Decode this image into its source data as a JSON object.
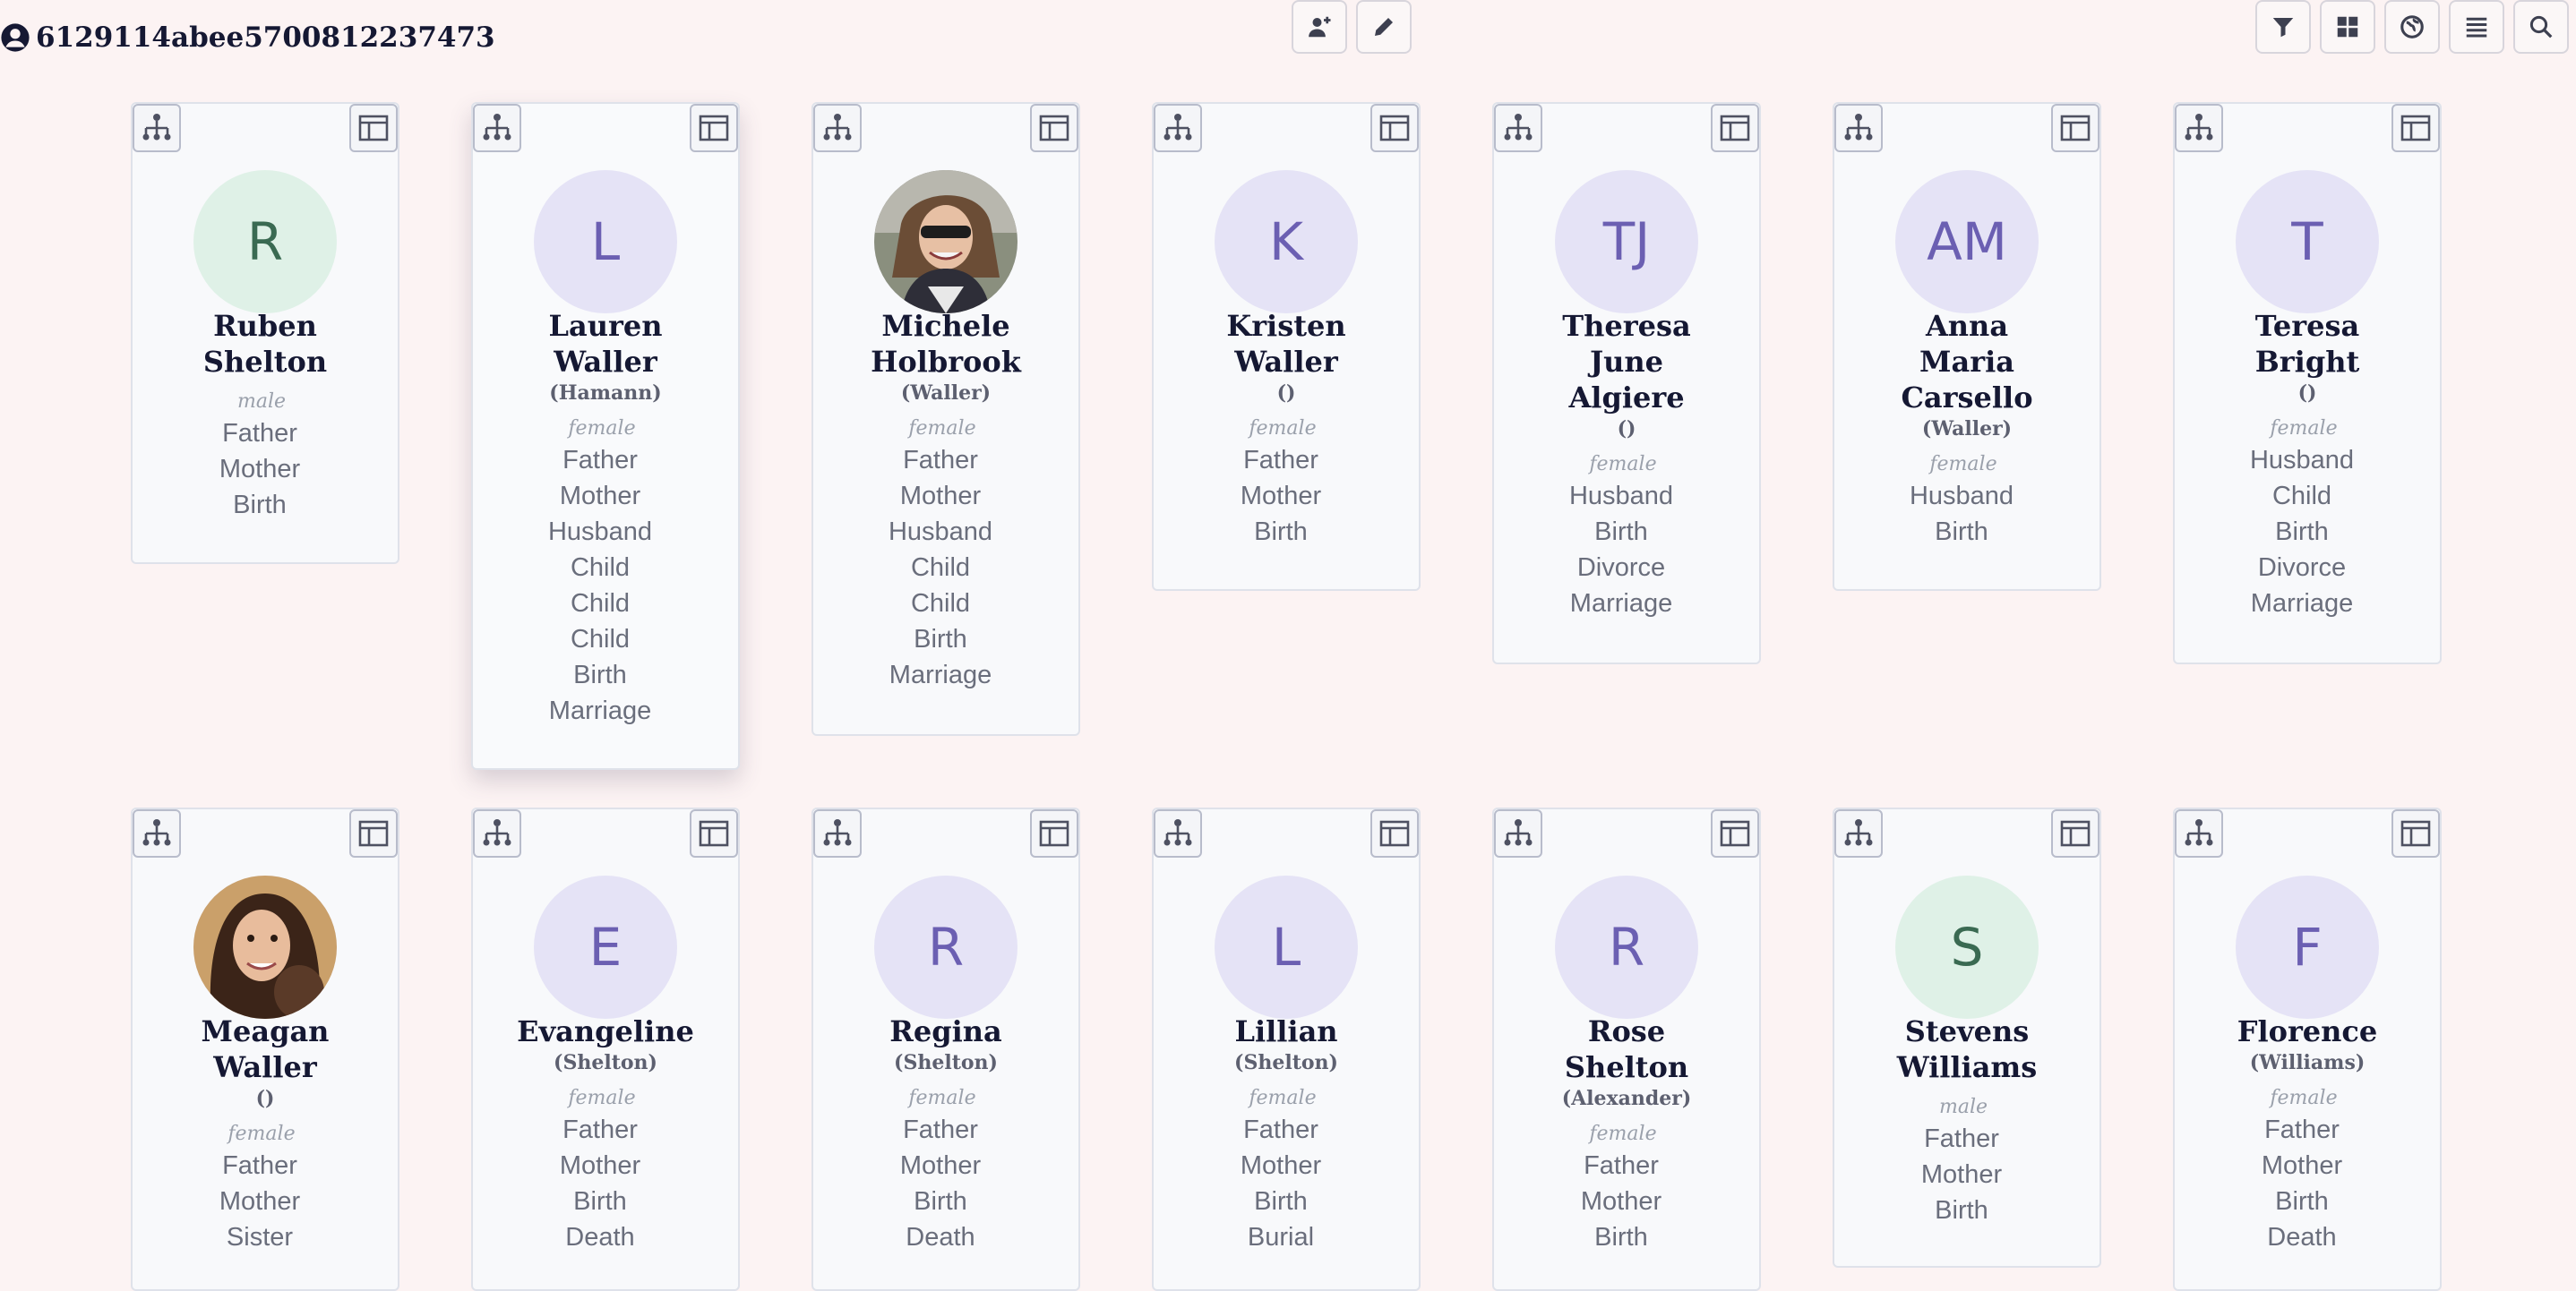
{
  "header": {
    "id_text": "6129114abee5700812237473"
  },
  "icons": {
    "person": "person-icon",
    "add_person": "add-person-icon",
    "edit": "pencil-icon",
    "filter": "filter-icon",
    "grid": "grid-icon",
    "globe": "globe-icon",
    "list": "list-icon",
    "search": "search-icon",
    "tree": "tree-icon",
    "layout": "layout-icon"
  },
  "colors": {
    "background": "#fcf3f3",
    "card": "#f8f9fb",
    "avatar_purple": "#e5e3f6",
    "avatar_green": "#dff1e7",
    "accent_text": "#6b5fb2"
  },
  "cards": [
    {
      "initials": "R",
      "name_lines": [
        "Ruben",
        "Shelton"
      ],
      "maiden": "",
      "sex": "male",
      "events": [
        "Father",
        "Mother",
        "Birth"
      ]
    },
    {
      "initials": "L",
      "name_lines": [
        "Lauren",
        "Waller"
      ],
      "maiden": "(Hamann)",
      "sex": "female",
      "events": [
        "Father",
        "Mother",
        "Husband",
        "Child",
        "Child",
        "Child",
        "Birth",
        "Marriage"
      ]
    },
    {
      "initials": "",
      "name_lines": [
        "Michele",
        "Holbrook"
      ],
      "maiden": "(Waller)",
      "sex": "female",
      "events": [
        "Father",
        "Mother",
        "Husband",
        "Child",
        "Child",
        "Birth",
        "Marriage"
      ]
    },
    {
      "initials": "K",
      "name_lines": [
        "Kristen",
        "Waller"
      ],
      "maiden": "()",
      "sex": "female",
      "events": [
        "Father",
        "Mother",
        "Birth"
      ]
    },
    {
      "initials": "TJ",
      "name_lines": [
        "Theresa",
        "June",
        "Algiere"
      ],
      "maiden": "()",
      "sex": "female",
      "events": [
        "Husband",
        "Birth",
        "Divorce",
        "Marriage"
      ]
    },
    {
      "initials": "AM",
      "name_lines": [
        "Anna",
        "Maria",
        "Carsello"
      ],
      "maiden": "(Waller)",
      "sex": "female",
      "events": [
        "Husband",
        "Birth"
      ]
    },
    {
      "initials": "T",
      "name_lines": [
        "Teresa",
        "Bright"
      ],
      "maiden": "()",
      "sex": "female",
      "events": [
        "Husband",
        "Child",
        "Birth",
        "Divorce",
        "Marriage"
      ]
    },
    {
      "initials": "",
      "name_lines": [
        "Meagan",
        "Waller"
      ],
      "maiden": "()",
      "sex": "female",
      "events": [
        "Father",
        "Mother",
        "Sister"
      ]
    },
    {
      "initials": "E",
      "name_lines": [
        "Evangeline"
      ],
      "maiden": "(Shelton)",
      "sex": "female",
      "events": [
        "Father",
        "Mother",
        "Birth",
        "Death"
      ]
    },
    {
      "initials": "R",
      "name_lines": [
        "Regina"
      ],
      "maiden": "(Shelton)",
      "sex": "female",
      "events": [
        "Father",
        "Mother",
        "Birth",
        "Death"
      ]
    },
    {
      "initials": "L",
      "name_lines": [
        "Lillian"
      ],
      "maiden": "(Shelton)",
      "sex": "female",
      "events": [
        "Father",
        "Mother",
        "Birth",
        "Burial"
      ]
    },
    {
      "initials": "R",
      "name_lines": [
        "Rose",
        "Shelton"
      ],
      "maiden": "(Alexander)",
      "sex": "female",
      "events": [
        "Father",
        "Mother",
        "Birth"
      ]
    },
    {
      "initials": "S",
      "name_lines": [
        "Stevens",
        "Williams"
      ],
      "maiden": "",
      "sex": "male",
      "events": [
        "Father",
        "Mother",
        "Birth"
      ]
    },
    {
      "initials": "F",
      "name_lines": [
        "Florence"
      ],
      "maiden": "(Williams)",
      "sex": "female",
      "events": [
        "Father",
        "Mother",
        "Birth",
        "Death"
      ]
    }
  ]
}
